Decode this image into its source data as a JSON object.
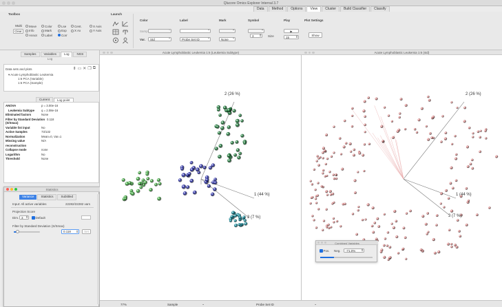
{
  "window": {
    "title": "Qlucore Omics Explorer  Internal 3.7"
  },
  "menu_tabs": [
    "Data",
    "Method",
    "Options",
    "View",
    "Cluster",
    "Build Classifier",
    "Classify"
  ],
  "menu_active": "View",
  "toolbox": {
    "title": "Toolbox",
    "modes": [
      "Multi",
      "Clear"
    ],
    "radios_col1": [
      {
        "label": "Move",
        "on": false
      },
      {
        "label": "Info",
        "on": false
      },
      {
        "label": "Annot",
        "on": false
      }
    ],
    "radios_col2": [
      {
        "label": "Color",
        "on": false
      },
      {
        "label": "Mark",
        "on": false
      },
      {
        "label": "Label",
        "on": false
      }
    ],
    "radios_col3": [
      {
        "label": "Lse",
        "on": false
      },
      {
        "label": "Exp",
        "on": false
      },
      {
        "label": "Corr",
        "on": true
      }
    ],
    "radios_col4": [
      {
        "label": "Cent.",
        "on": false
      },
      {
        "label": "X Ax",
        "on": false
      }
    ],
    "radios_col5": [
      {
        "label": "X Axis",
        "on": false
      },
      {
        "label": "Y Axis",
        "on": false
      }
    ]
  },
  "launch": {
    "title": "Launch"
  },
  "color": {
    "title": "Color",
    "samp_label": "Samp",
    "var_label": "Var.",
    "var_value": "Std"
  },
  "label_group": {
    "title": "Label",
    "var_value": "Probe Set ID"
  },
  "mark": {
    "title": "Mark",
    "var_value": "None"
  },
  "symbol": {
    "title": "Symbol",
    "value": "3",
    "size_label": "Size"
  },
  "play": {
    "title": "Play",
    "value": "15"
  },
  "plot_settings": {
    "title": "Plot Settings",
    "show_label": "Show"
  },
  "left_tabs": [
    "Samples",
    "Variables",
    "Log",
    "NGS"
  ],
  "left_tabs_active": "Log",
  "log_title": "Log",
  "datasets": {
    "title": "Data sets and plots",
    "items": [
      "Acute Lymphoblastic Leukemia",
      "1:6 PCA (Variable)",
      "1:6 PCA (Sample)"
    ]
  },
  "logpoint_tabs": [
    "Current",
    "Log point"
  ],
  "logpoint_active": "Log point",
  "logpoint_rows": [
    {
      "k": "ANOVA",
      "v": "p = 3.00e-16"
    },
    {
      "k": "Leukemia Subtype",
      "v": "q = 2.08e-16"
    },
    {
      "k": "Eliminated factors",
      "v": "None"
    },
    {
      "k": "Filter by Standard Deviation (S/Smax)",
      "v": "0.118"
    },
    {
      "k": "Variable list input",
      "v": "No"
    },
    {
      "k": "Active Samples",
      "v": "73/132"
    },
    {
      "k": "Normalization",
      "v": "Mean=0, Var=1"
    },
    {
      "k": "Missing value reconstruction",
      "v": "N/A"
    },
    {
      "k": "Collapse mode",
      "v": "none"
    },
    {
      "k": "Logarithm",
      "v": "No"
    },
    {
      "k": "Threshold",
      "v": "None"
    }
  ],
  "statistics": {
    "title": "Statistics",
    "tabs": [
      "Variance",
      "Statistics",
      "Subtitled"
    ],
    "tabs_active": "Variance",
    "input_label": "Input: All active variables",
    "input_value": "22282/22282 vars",
    "projection_title": "Projection Score",
    "dim_label": "Dim.",
    "dim_value": "3",
    "default_label": "Default",
    "filter_title": "Filter by Standard Deviation (S/Smax)",
    "filter_value": "0.118",
    "set_label": "Set",
    "slider_fraction": 0.15
  },
  "plot_left": {
    "title": "Acute Lymphoblastic Leukemia 1:6 (Leukemia Subtype)",
    "axis1": "1 (44 %)",
    "axis2": "2 (26 %)",
    "axis3": "3 (7 %)",
    "colors": {
      "green": "#3fa83f",
      "blue": "#2a2fa8",
      "darkgreen": "#1e7a3a",
      "teal": "#138a9a"
    }
  },
  "plot_right": {
    "title": "Acute Lymphoblastic Leukemia 1:6 (std)",
    "axis1": "1 (44 %)",
    "axis2": "2 (26 %)",
    "axis3": "3 (7 %)",
    "point_color": "#e08a8a"
  },
  "combined_variables": {
    "title": "Combined Variables",
    "pos_label": "Pos.",
    "neg_label": "Neg.",
    "neg_value": "-71.0%"
  },
  "status_bar": {
    "zoom": "77%",
    "sample_select": "Sample",
    "probe_select": "Probe Set ID"
  }
}
